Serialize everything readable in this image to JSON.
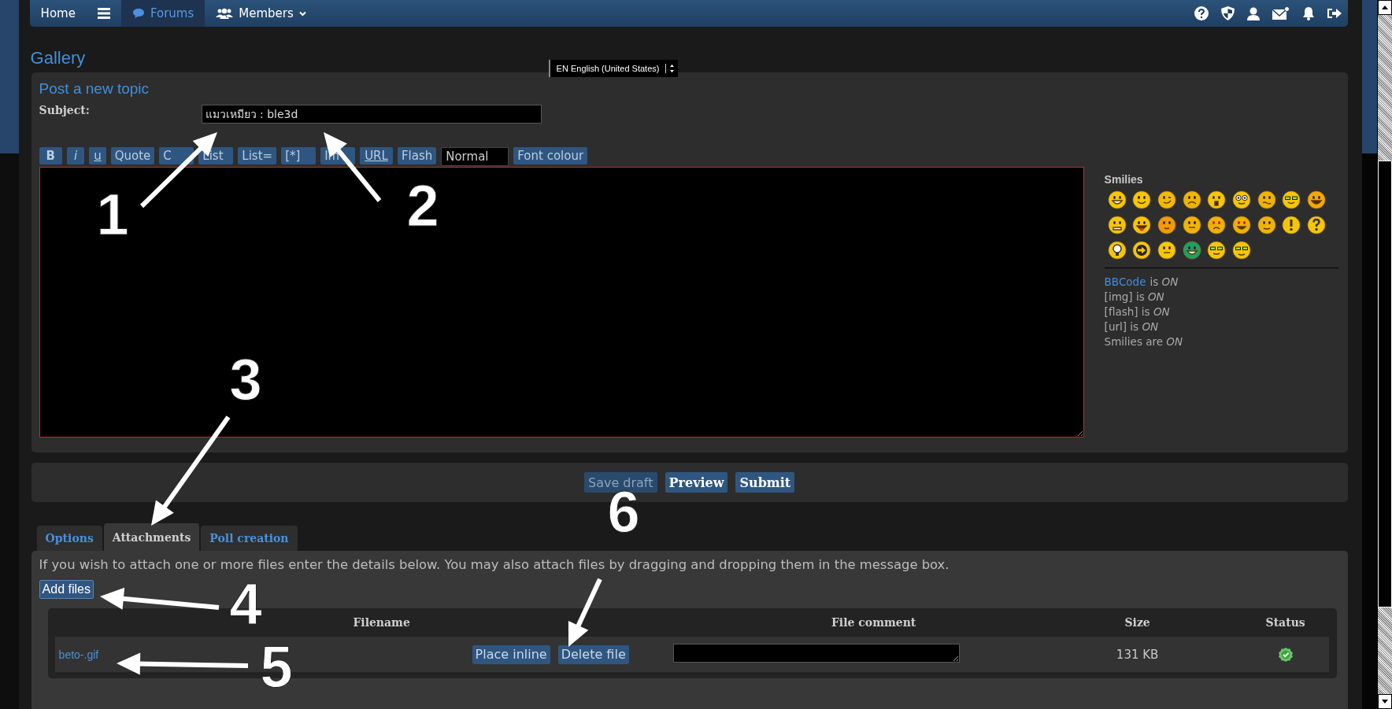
{
  "nav": {
    "items": [
      {
        "kind": "plain",
        "label": "Home",
        "selected": false
      },
      {
        "kind": "menu",
        "selected": false
      },
      {
        "kind": "bubble",
        "label": "Forums",
        "selected": true
      },
      {
        "kind": "people",
        "label": "Members",
        "selected": false
      }
    ]
  },
  "page_title": "Gallery",
  "language": {
    "value": "EN English (United States)"
  },
  "compose": {
    "title": "Post a new topic",
    "subject_label": "Subject:",
    "subject_value": "แมวเหมียว : ble3d",
    "toolbar": [
      {
        "kind": "bold",
        "label": "B"
      },
      {
        "kind": "italic",
        "label": "i"
      },
      {
        "kind": "underline",
        "label": "u"
      },
      {
        "kind": "button",
        "label": "Quote"
      },
      {
        "kind": "button",
        "label": "C"
      },
      {
        "kind": "button",
        "label": "List"
      },
      {
        "kind": "button",
        "label": "List="
      },
      {
        "kind": "button",
        "label": "[*]"
      },
      {
        "kind": "button",
        "label": "Im"
      },
      {
        "kind": "underline",
        "label": "URL"
      },
      {
        "kind": "button",
        "label": "Flash"
      },
      {
        "kind": "select",
        "label": "Normal"
      },
      {
        "kind": "button",
        "label": "Font colour"
      }
    ]
  },
  "smilies": {
    "title": "Smilies",
    "items": [
      {
        "kind": "grin"
      },
      {
        "kind": "smile"
      },
      {
        "kind": "wink"
      },
      {
        "kind": "sad"
      },
      {
        "kind": "shock"
      },
      {
        "kind": "eyes"
      },
      {
        "kind": "worried"
      },
      {
        "kind": "cool"
      },
      {
        "kind": "laugh"
      },
      {
        "kind": "mad"
      },
      {
        "kind": "tongue"
      },
      {
        "kind": "blush"
      },
      {
        "kind": "flat"
      },
      {
        "kind": "angry"
      },
      {
        "kind": "evil"
      },
      {
        "kind": "squint"
      },
      {
        "kind": "exclaim"
      },
      {
        "kind": "question"
      },
      {
        "kind": "idea"
      },
      {
        "kind": "arrow"
      },
      {
        "kind": "smirk"
      },
      {
        "kind": "green"
      },
      {
        "kind": "geek"
      },
      {
        "kind": "nerd"
      }
    ]
  },
  "status_lines": [
    {
      "link": "BBCode",
      "text": "is *ON*"
    },
    {
      "text": "[img] is *ON*"
    },
    {
      "text": "[flash] is *ON*"
    },
    {
      "text": "[url] is *ON*"
    },
    {
      "text": "Smilies are *ON*"
    }
  ],
  "actions": [
    {
      "label": "Save draft",
      "kind": "secondary"
    },
    {
      "label": "Preview",
      "kind": "primary"
    },
    {
      "label": "Submit",
      "kind": "primary"
    }
  ],
  "tabs": [
    {
      "label": "Options",
      "selected": false
    },
    {
      "label": "Attachments",
      "selected": true
    },
    {
      "label": "Poll creation",
      "selected": false
    }
  ],
  "attachments": {
    "intro": "If you wish to attach one or more files enter the details below. You may also attach files by dragging and dropping them in the message box.",
    "add_button": "Add files",
    "columns": [
      "Filename",
      "File comment",
      "Size",
      "Status"
    ],
    "rows": [
      {
        "filename": "beto-.gif",
        "buttons": [
          "Place inline",
          "Delete file"
        ],
        "size": "131 KB"
      }
    ]
  },
  "annotations": [
    "1",
    "2",
    "3",
    "4",
    "5",
    "6"
  ]
}
